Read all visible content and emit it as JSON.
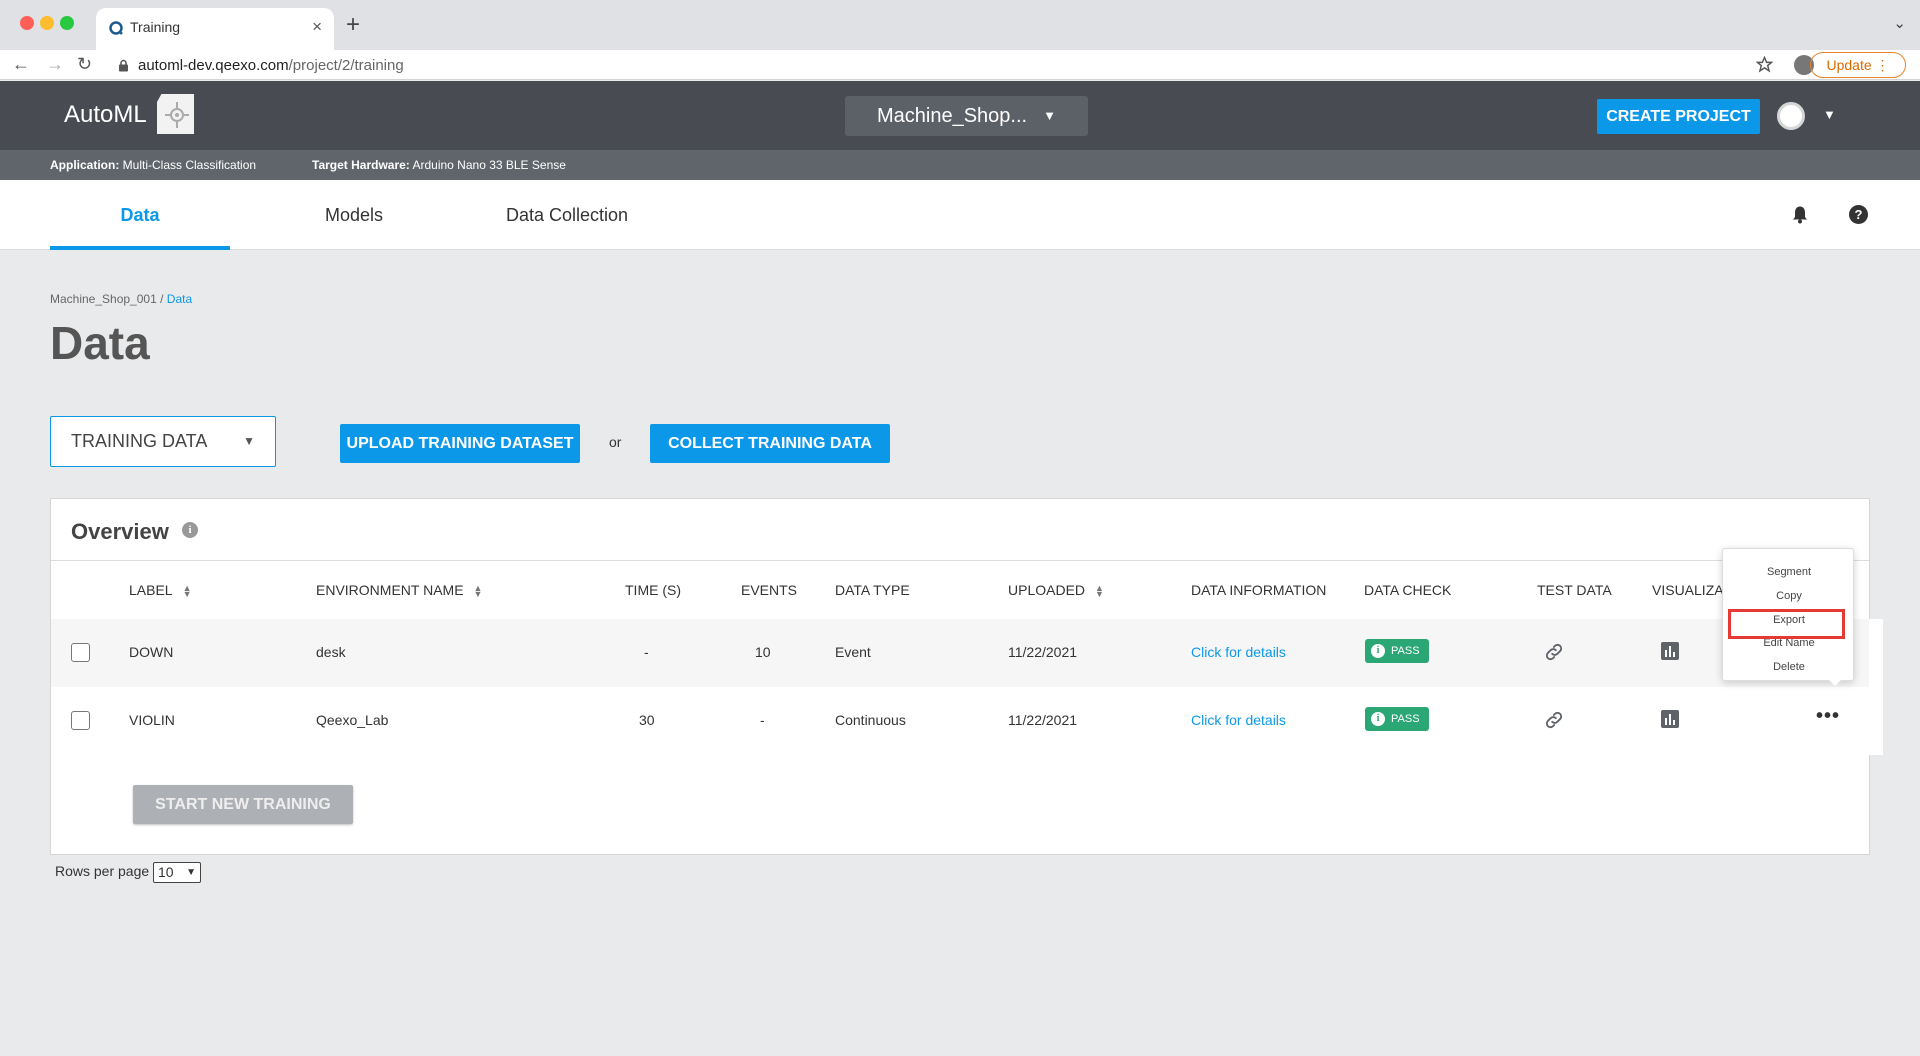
{
  "browser": {
    "tab_title": "Training",
    "url_domain": "automl-dev.qeexo.com",
    "url_path": "/project/2/training",
    "update_label": "Update",
    "colors": {
      "close": "#ff5f57",
      "minimize": "#febc2e",
      "maximize": "#28c840"
    }
  },
  "header": {
    "logo": "AutoML",
    "project_name": "Machine_Shop...",
    "create_project": "CREATE PROJECT",
    "application_label": "Application:",
    "application_value": "Multi-Class Classification",
    "hardware_label": "Target Hardware:",
    "hardware_value": "Arduino Nano 33 BLE Sense"
  },
  "nav": {
    "data": "Data",
    "models": "Models",
    "collection": "Data Collection"
  },
  "breadcrumb": {
    "project": "Machine_Shop_001",
    "separator": "/",
    "current": "Data"
  },
  "page_title": "Data",
  "dataset_select": "TRAINING DATA",
  "actions": {
    "upload": "UPLOAD TRAINING DATASET",
    "or": "or",
    "collect": "COLLECT TRAINING DATA"
  },
  "overview": {
    "title": "Overview",
    "columns": [
      "LABEL",
      "ENVIRONMENT NAME",
      "TIME (S)",
      "EVENTS",
      "DATA TYPE",
      "UPLOADED",
      "DATA INFORMATION",
      "DATA CHECK",
      "TEST DATA",
      "VISUALIZA"
    ],
    "rows": [
      {
        "label": "DOWN",
        "env": "desk",
        "time": "-",
        "events": "10",
        "type": "Event",
        "uploaded": "11/22/2021",
        "info": "Click for details",
        "check": "PASS"
      },
      {
        "label": "VIOLIN",
        "env": "Qeexo_Lab",
        "time": "30",
        "events": "-",
        "type": "Continuous",
        "uploaded": "11/22/2021",
        "info": "Click for details",
        "check": "PASS"
      }
    ],
    "start_training": "START NEW TRAINING"
  },
  "pagination": {
    "rows_per_page_label": "Rows per page",
    "rows_per_page_value": "10"
  },
  "context_menu": [
    "Segment",
    "Copy",
    "Export",
    "Edit Name",
    "Delete"
  ],
  "icons": {
    "tab": "qeexo-logo-icon",
    "bell": "bell-icon",
    "help": "help-icon",
    "info": "info-icon",
    "link": "link-icon",
    "chart": "bar-chart-icon",
    "more": "more-horizontal-icon"
  },
  "theme": {
    "accent": "#0c98e8",
    "header_bg": "#484c52",
    "pass": "#2aa775",
    "highlight": "#e53935"
  }
}
